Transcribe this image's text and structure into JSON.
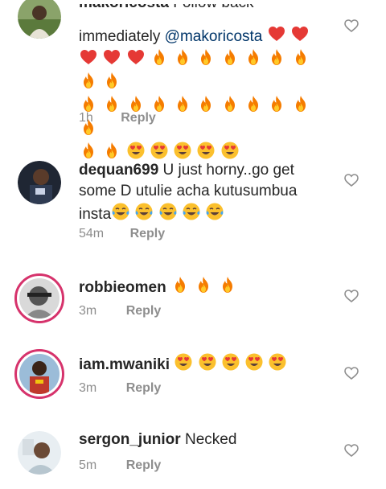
{
  "comments": [
    {
      "username": "makoricosta",
      "text_prefix": "Follow back",
      "text_mid": "immediately",
      "mention": "@makoricosta",
      "emoji_line1": [
        "red-heart",
        "red-heart"
      ],
      "emoji_line2": [
        "red-heart",
        "red-heart",
        "red-heart",
        "fire",
        "fire",
        "fire",
        "fire",
        "fire",
        "fire",
        "fire",
        "fire",
        "fire"
      ],
      "emoji_line3": [
        "fire",
        "fire",
        "fire",
        "fire",
        "fire",
        "fire",
        "fire",
        "fire",
        "fire",
        "fire",
        "fire"
      ],
      "emoji_line4": [
        "fire",
        "fire",
        "heart-eyes",
        "heart-eyes",
        "heart-eyes",
        "heart-eyes",
        "heart-eyes"
      ],
      "time": "1h",
      "reply_label": "Reply"
    },
    {
      "username": "dequan699",
      "text_line1": "U just horny..go get",
      "text_line2": "some D utulie acha kutusumbua",
      "text_line3": "insta",
      "emoji_line3": [
        "tears-of-joy",
        "tears-of-joy",
        "tears-of-joy",
        "tears-of-joy",
        "tears-of-joy"
      ],
      "time": "54m",
      "reply_label": "Reply"
    },
    {
      "username": "robbieomen",
      "emojis": [
        "fire",
        "fire",
        "fire"
      ],
      "time": "3m",
      "reply_label": "Reply"
    },
    {
      "username": "iam.mwaniki",
      "emojis": [
        "heart-eyes",
        "heart-eyes",
        "heart-eyes",
        "heart-eyes",
        "heart-eyes"
      ],
      "time": "3m",
      "reply_label": "Reply"
    },
    {
      "username": "sergon_junior",
      "text": "Necked",
      "time": "5m",
      "reply_label": "Reply"
    }
  ],
  "colors": {
    "username": "#262626",
    "mention": "#003569",
    "meta": "#8e8e8e",
    "story_ring": "#d6336c"
  }
}
